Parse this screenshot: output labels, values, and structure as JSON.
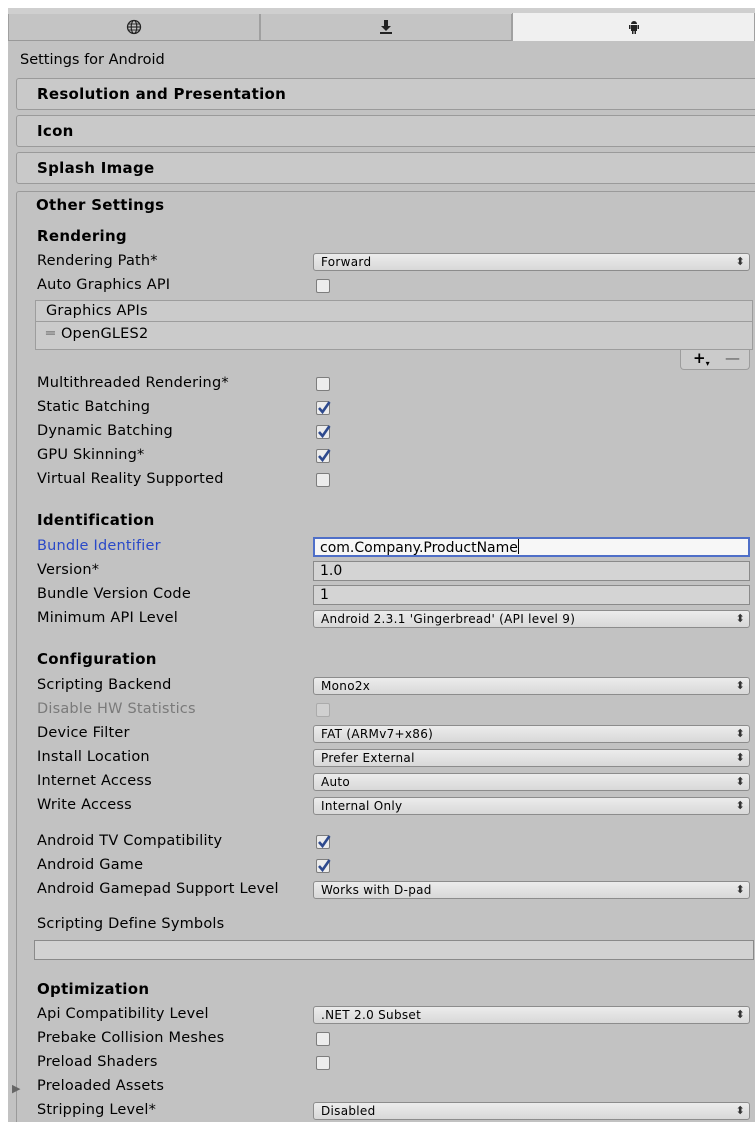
{
  "tabs": [
    {
      "icon": "globe-icon"
    },
    {
      "icon": "download-icon"
    },
    {
      "icon": "android-icon",
      "active": true
    }
  ],
  "settings_title": "Settings for Android",
  "sections": {
    "resolution": "Resolution and Presentation",
    "icon": "Icon",
    "splash": "Splash Image",
    "other": "Other Settings"
  },
  "rendering": {
    "header": "Rendering",
    "rendering_path": {
      "label": "Rendering Path*",
      "value": "Forward"
    },
    "auto_graphics_api": {
      "label": "Auto Graphics API",
      "checked": false
    },
    "graphics_apis": {
      "header": "Graphics APIs",
      "items": [
        "OpenGLES2"
      ],
      "add": "+",
      "add_suffix": "▾",
      "remove": "—"
    },
    "multithreaded": {
      "label": "Multithreaded Rendering*",
      "checked": false
    },
    "static_batching": {
      "label": "Static Batching",
      "checked": true
    },
    "dynamic_batching": {
      "label": "Dynamic Batching",
      "checked": true
    },
    "gpu_skinning": {
      "label": "GPU Skinning*",
      "checked": true
    },
    "vr_supported": {
      "label": "Virtual Reality Supported",
      "checked": false
    }
  },
  "identification": {
    "header": "Identification",
    "bundle_identifier": {
      "label": "Bundle Identifier",
      "value": "com.Company.ProductName"
    },
    "version": {
      "label": "Version*",
      "value": "1.0"
    },
    "bundle_version_code": {
      "label": "Bundle Version Code",
      "value": "1"
    },
    "minimum_api_level": {
      "label": "Minimum API Level",
      "value": "Android 2.3.1 'Gingerbread' (API level 9)"
    }
  },
  "configuration": {
    "header": "Configuration",
    "scripting_backend": {
      "label": "Scripting Backend",
      "value": "Mono2x"
    },
    "disable_hw_statistics": {
      "label": "Disable HW Statistics",
      "checked": false,
      "disabled": true
    },
    "device_filter": {
      "label": "Device Filter",
      "value": "FAT (ARMv7+x86)"
    },
    "install_location": {
      "label": "Install Location",
      "value": "Prefer External"
    },
    "internet_access": {
      "label": "Internet Access",
      "value": "Auto"
    },
    "write_access": {
      "label": "Write Access",
      "value": "Internal Only"
    },
    "android_tv": {
      "label": "Android TV Compatibility",
      "checked": true
    },
    "android_game": {
      "label": "Android Game",
      "checked": true
    },
    "gamepad_support": {
      "label": "Android Gamepad Support Level",
      "value": "Works with D-pad"
    },
    "scripting_define_symbols": {
      "label": "Scripting Define Symbols",
      "value": ""
    }
  },
  "optimization": {
    "header": "Optimization",
    "api_compatibility": {
      "label": "Api Compatibility Level",
      "value": ".NET 2.0 Subset"
    },
    "prebake_collision": {
      "label": "Prebake Collision Meshes",
      "checked": false
    },
    "preload_shaders": {
      "label": "Preload Shaders",
      "checked": false
    },
    "preloaded_assets": {
      "label": "Preloaded Assets",
      "expanded": false
    },
    "stripping_level": {
      "label": "Stripping Level*",
      "value": "Disabled"
    }
  },
  "dropdown_arrow": "⬍",
  "foldout_arrow": "▶"
}
